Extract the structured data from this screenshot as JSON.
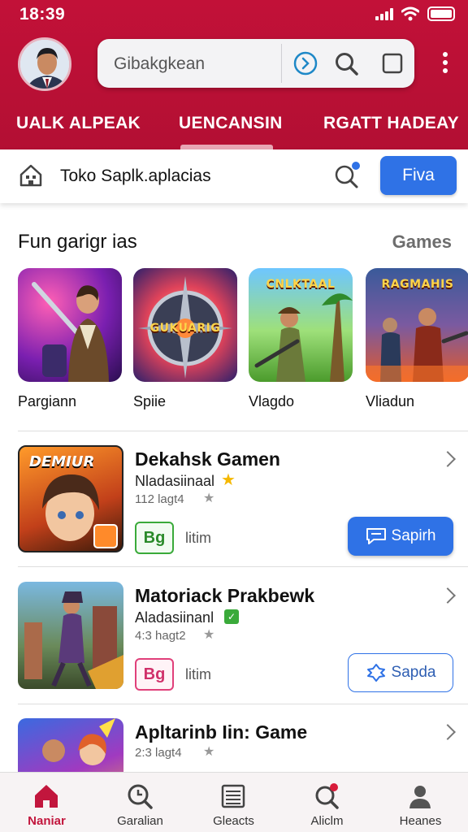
{
  "status": {
    "time": "18:39"
  },
  "search": {
    "placeholder": "Gibakgkean"
  },
  "tabs": [
    {
      "label": "UALK ALPEAK"
    },
    {
      "label": "UENCANSIN"
    },
    {
      "label": "RGATT HADEAY"
    }
  ],
  "store": {
    "title": "Toko Saplk.aplacias",
    "button": "Fiva"
  },
  "section": {
    "title": "Fun garigr ias",
    "link": "Games",
    "games": [
      {
        "label": "Pargiann",
        "thumb_text": ""
      },
      {
        "label": "Spiie",
        "thumb_text": "GUKUARIG"
      },
      {
        "label": "Vlagdo",
        "thumb_text": "CNLKTAAL"
      },
      {
        "label": "Vliadun",
        "thumb_text": "RAGMAHIS"
      }
    ]
  },
  "apps": [
    {
      "name": "Dekahsk Gamen",
      "subtitle": "Nladasiinaal",
      "meta": "112 lagt4",
      "tag": "litim",
      "action": "Sapirh",
      "icon_text": "DEMIUR"
    },
    {
      "name": "Matoriack Prakbewk",
      "subtitle": "Aladasiinanl",
      "meta": "4:3 hagt2",
      "tag": "litim",
      "action": "Sapda",
      "icon_text": ""
    },
    {
      "name": "Apltarinb Iin: Game",
      "subtitle": "",
      "meta": "2:3 lagt4",
      "tag": "",
      "action": "",
      "icon_text": ""
    }
  ],
  "nav": [
    {
      "label": "Naniar"
    },
    {
      "label": "Garalian"
    },
    {
      "label": "Gleacts"
    },
    {
      "label": "Aliclm"
    },
    {
      "label": "Heanes"
    }
  ],
  "colors": {
    "brand": "#c21138",
    "accent": "#2f72e6"
  }
}
